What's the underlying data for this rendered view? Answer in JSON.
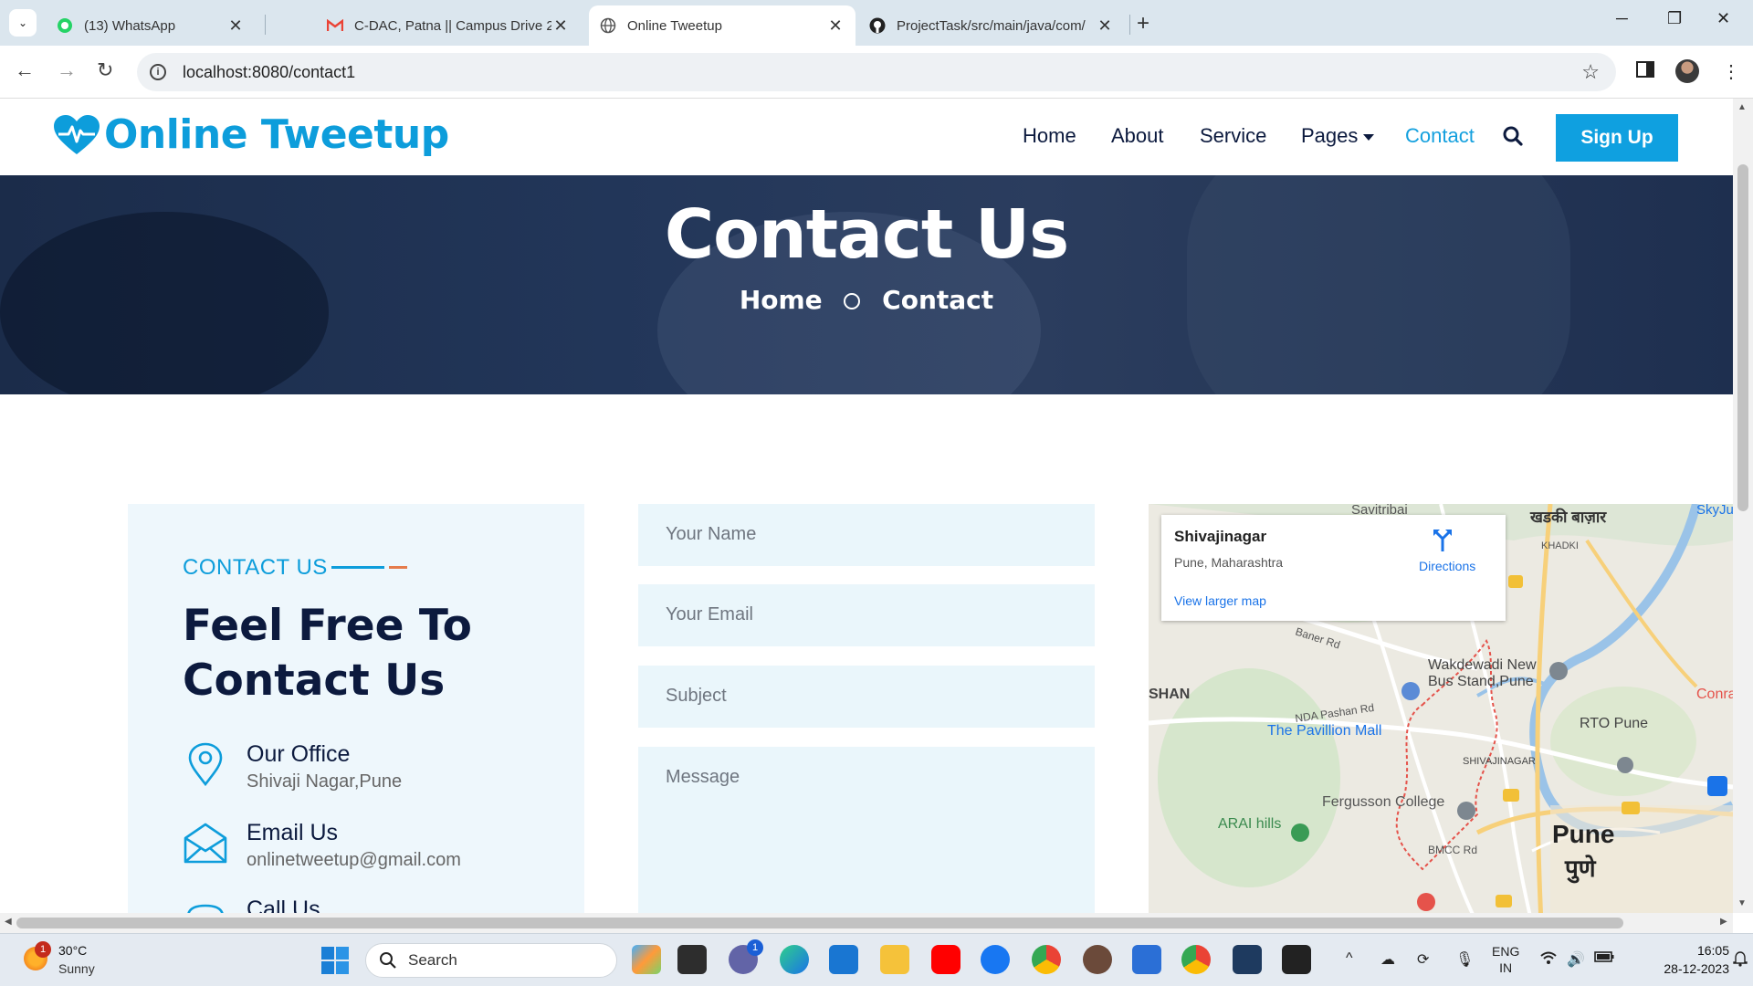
{
  "browser": {
    "tabs": [
      {
        "title": "(13) WhatsApp",
        "icon": "whatsapp-icon"
      },
      {
        "title": "C-DAC, Patna || Campus Drive 2",
        "icon": "gmail-icon"
      },
      {
        "title": "Online Tweetup",
        "icon": "globe-icon",
        "active": true
      },
      {
        "title": "ProjectTask/src/main/java/com/",
        "icon": "github-icon"
      }
    ],
    "url": "localhost:8080/contact1"
  },
  "site": {
    "brand": "Online Tweetup",
    "nav": {
      "home": "Home",
      "about": "About",
      "service": "Service",
      "pages": "Pages",
      "contact": "Contact",
      "signup": "Sign Up"
    },
    "hero": {
      "title": "Contact Us",
      "crumb_home": "Home",
      "crumb_current": "Contact"
    },
    "card": {
      "eyebrow": "CONTACT US",
      "heading": "Feel Free To Contact Us",
      "office_label": "Our Office",
      "office_value": "Shivaji Nagar,Pune",
      "email_label": "Email Us",
      "email_value": "onlinetweetup@gmail.com",
      "call_label": "Call Us"
    },
    "form": {
      "name_placeholder": "Your Name",
      "email_placeholder": "Your Email",
      "subject_placeholder": "Subject",
      "message_placeholder": "Message"
    },
    "map": {
      "place": "Shivajinagar",
      "region": "Pune, Maharashtra",
      "directions": "Directions",
      "larger": "View larger map",
      "labels": {
        "savitribai": "Savitribai",
        "khadki_bazar": "खडकी बाज़ार",
        "khadki": "KHADKI",
        "baner_rd": "Baner Rd",
        "wakdewadi": "Wakdewadi New Bus Stand,Pune",
        "shan": "SHAN",
        "nda_pashan": "NDA Pashan Rd",
        "pavillion": "The Pavillion Mall",
        "rto": "RTO Pune",
        "shivajinagar_map": "SHIVAJINAGAR",
        "fergusson": "Fergusson College",
        "arai": "ARAI hills",
        "pune": "Pune",
        "pune_hi": "पुणे",
        "bmcc": "BMCC Rd",
        "skyju": "SkyJu",
        "conra": "Conra"
      }
    }
  },
  "taskbar": {
    "temp": "30°C",
    "weather": "Sunny",
    "weather_badge": "1",
    "search": "Search",
    "lang1": "ENG",
    "lang2": "IN",
    "time": "16:05",
    "date": "28-12-2023",
    "chat_badge": "1"
  },
  "colors": {
    "brand": "#0d9ddb",
    "navy": "#0c1a3e",
    "accent_orange": "#e57c4c"
  }
}
